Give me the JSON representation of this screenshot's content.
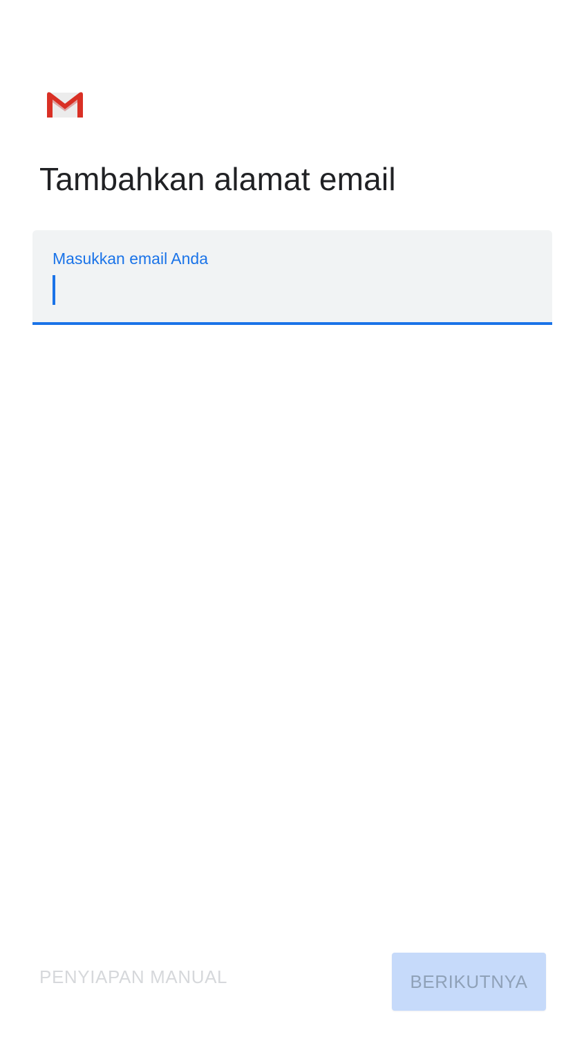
{
  "logo": {
    "icon": "gmail-icon"
  },
  "title": "Tambahkan alamat email",
  "email_field": {
    "label": "Masukkan email Anda",
    "value": "",
    "accent_color": "#1a73e8"
  },
  "actions": {
    "manual_setup_label": "PENYIAPAN MANUAL",
    "next_label": "BERIKUTNYA"
  },
  "colors": {
    "gmail_red": "#d93025",
    "button_disabled_bg": "#c6dafa"
  }
}
